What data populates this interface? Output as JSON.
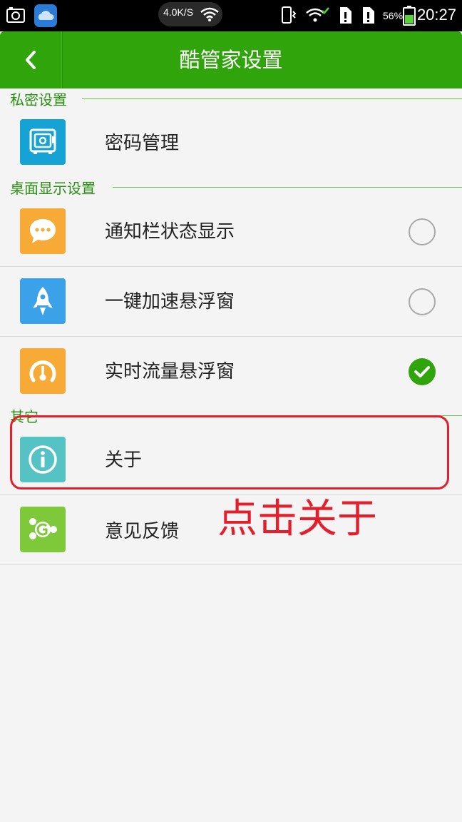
{
  "status_bar": {
    "net_speed": "4.0K/S",
    "battery_percent": "56%",
    "time": "20:27",
    "icons": [
      "screenshot-icon",
      "weather-app-icon",
      "wifi-icon",
      "vibrate-icon",
      "wifi-check-icon",
      "sim1-icon",
      "sim2-icon",
      "battery-icon"
    ]
  },
  "header": {
    "back_icon": "chevron-left-icon",
    "title": "酷管家设置"
  },
  "sections": [
    {
      "label": "私密设置",
      "items": [
        {
          "label": "密码管理",
          "icon": "safe-icon",
          "icon_color": "#15a3d6"
        }
      ]
    },
    {
      "label": "桌面显示设置",
      "items": [
        {
          "label": "通知栏状态显示",
          "icon": "chat-bubble-icon",
          "icon_color": "#f7ab36",
          "checked": false
        },
        {
          "label": "一键加速悬浮窗",
          "icon": "rocket-icon",
          "icon_color": "#3ba1e8",
          "checked": false
        },
        {
          "label": "实时流量悬浮窗",
          "icon": "gauge-icon",
          "icon_color": "#f7ab36",
          "checked": true
        }
      ]
    },
    {
      "label": "其它",
      "items": [
        {
          "label": "关于",
          "icon": "info-icon",
          "icon_color": "#55c2c3"
        },
        {
          "label": "意见反馈",
          "icon": "feedback-icon",
          "icon_color": "#7dc93a"
        }
      ]
    }
  ],
  "annotation": {
    "text": "点击关于",
    "color": "#e41e2b"
  },
  "colors": {
    "header_green": "#2fa40b",
    "section_text": "#2a8f12",
    "check_on": "#2fa40b"
  }
}
